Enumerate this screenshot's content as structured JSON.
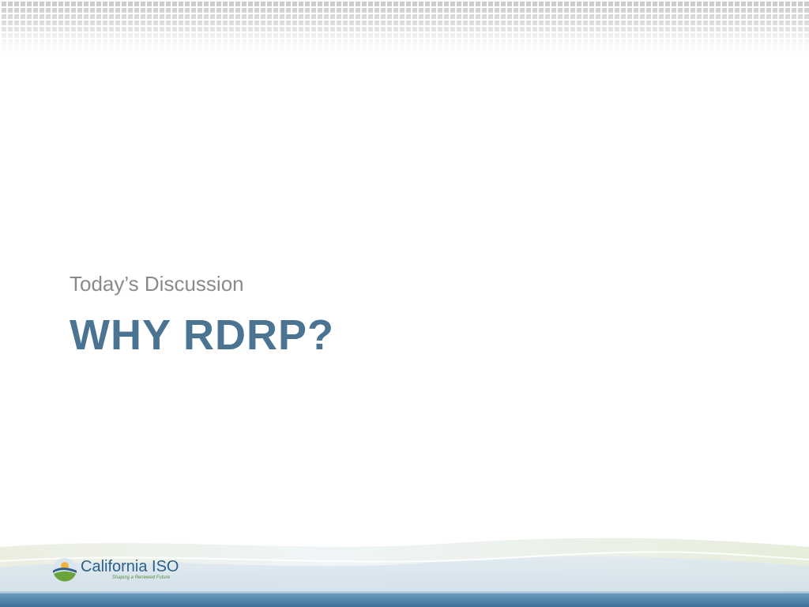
{
  "slide": {
    "subtitle": "Today’s Discussion",
    "title": "WHY RDRP?"
  },
  "footer": {
    "logo": {
      "name": "California ISO",
      "tagline": "Shaping a Renewed Future",
      "icon": "california-iso-logo-icon"
    }
  },
  "colors": {
    "title": "#4a7491",
    "subtitle": "#8a8a8a",
    "footer_bar": "#4a7fa6",
    "logo_blue": "#2d5f8a",
    "logo_green": "#6aa33a",
    "logo_sun": "#f0b43a"
  }
}
